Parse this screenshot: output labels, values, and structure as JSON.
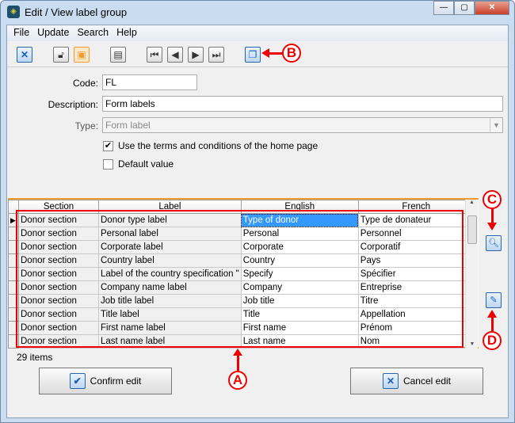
{
  "window": {
    "title": "Edit / View label group"
  },
  "menu": [
    "File",
    "Update",
    "Search",
    "Help"
  ],
  "toolbar": {
    "icons": [
      "close-icon",
      "unlock-icon",
      "save-icon",
      "print-icon",
      "first-record-icon",
      "previous-record-icon",
      "next-record-icon",
      "last-record-icon",
      "copy-icon"
    ]
  },
  "form": {
    "code_label": "Code:",
    "code_value": "FL",
    "description_label": "Description:",
    "description_value": "Form labels",
    "type_label": "Type:",
    "type_value": "Form label",
    "terms_label": "Use the terms and conditions of the home page",
    "terms_checked": true,
    "default_label": "Default value",
    "default_checked": false
  },
  "grid": {
    "columns": [
      "Section",
      "Label",
      "English",
      "French"
    ],
    "rows": [
      [
        "Donor section",
        "Donor type label",
        "Type of donor",
        "Type de donateur"
      ],
      [
        "Donor section",
        "Personal label",
        "Personal",
        "Personnel"
      ],
      [
        "Donor section",
        "Corporate label",
        "Corporate",
        "Corporatif"
      ],
      [
        "Donor section",
        "Country label",
        "Country",
        "Pays"
      ],
      [
        "Donor section",
        "Label of the country specification \"",
        "Specify",
        "Spécifier"
      ],
      [
        "Donor section",
        "Company name label",
        "Company",
        "Entreprise"
      ],
      [
        "Donor section",
        "Job title label",
        "Job title",
        "Titre"
      ],
      [
        "Donor section",
        "Title label",
        "Title",
        "Appellation"
      ],
      [
        "Donor section",
        "First name label",
        "First name",
        "Prénom"
      ],
      [
        "Donor section",
        "Last name label",
        "Last name",
        "Nom"
      ]
    ],
    "status": "29 items"
  },
  "buttons": {
    "confirm": "Confirm edit",
    "cancel": "Cancel edit"
  },
  "annotations": {
    "a": "A",
    "b": "B",
    "c": "C",
    "d": "D"
  },
  "colors": {
    "annotation": "#ee0000",
    "selection": "#3399ff",
    "grid_border": "#f39b2c"
  }
}
